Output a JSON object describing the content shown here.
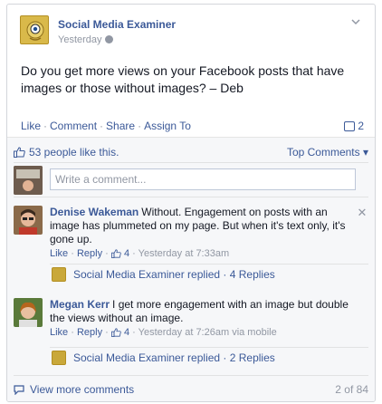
{
  "post": {
    "page_name": "Social Media Examiner",
    "time": "Yesterday",
    "text": "Do you get more views on your Facebook posts that have images or those without images? – Deb"
  },
  "actions": {
    "like": "Like",
    "comment": "Comment",
    "share": "Share",
    "assign": "Assign To",
    "comment_count": "2"
  },
  "ufi": {
    "likes_text": "53 people like this.",
    "top_comments": "Top Comments ▾",
    "write_placeholder": "Write a comment...",
    "view_more": "View more comments",
    "pager": "2 of 84"
  },
  "comments": [
    {
      "author": "Denise Wakeman",
      "text": "Without. Engagement on posts with an image has plummeted on my page. But when it's text only, it's gone up.",
      "like": "Like",
      "reply": "Reply",
      "likes": "4",
      "time": "Yesterday at 7:33am",
      "replied": "Social Media Examiner replied · 4 Replies"
    },
    {
      "author": "Megan Kerr",
      "text": "I get more engagement with an image but double the views without an image.",
      "like": "Like",
      "reply": "Reply",
      "likes": "4",
      "time": "Yesterday at 7:26am via mobile",
      "replied": "Social Media Examiner replied · 2 Replies"
    }
  ],
  "colors": {
    "link": "#3b5998",
    "muted": "#9197a3",
    "ufi_bg": "#f6f7f9"
  }
}
